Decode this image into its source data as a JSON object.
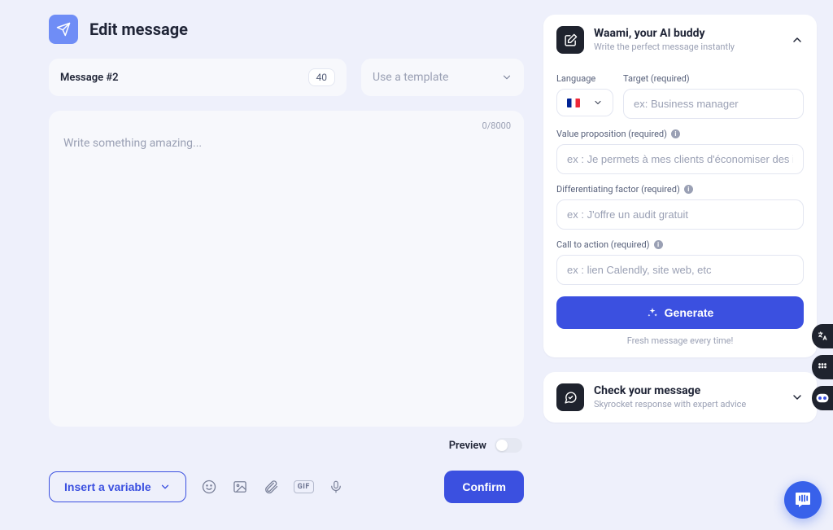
{
  "header": {
    "title": "Edit message"
  },
  "message": {
    "label": "Message #2",
    "count": "40"
  },
  "template": {
    "placeholder": "Use a template"
  },
  "editor": {
    "counter": "0/8000",
    "placeholder": "Write something amazing..."
  },
  "preview": {
    "label": "Preview"
  },
  "insert": {
    "label": "Insert a variable"
  },
  "confirm": {
    "label": "Confirm"
  },
  "ai": {
    "title": "Waami, your AI buddy",
    "subtitle": "Write the perfect message instantly",
    "language_label": "Language",
    "target": {
      "label": "Target (required)",
      "placeholder": "ex: Business manager"
    },
    "value_prop": {
      "label": "Value proposition (required)",
      "placeholder": "ex : Je permets à mes clients d'économiser des impôts"
    },
    "diff": {
      "label": "Differentiating factor (required)",
      "placeholder": "ex : J'offre un audit gratuit"
    },
    "cta": {
      "label": "Call to action (required)",
      "placeholder": "ex : lien Calendly, site web, etc"
    },
    "generate": "Generate",
    "fresh": "Fresh message every time!"
  },
  "check": {
    "title": "Check your message",
    "subtitle": "Skyrocket response with expert advice"
  },
  "gif_label": "GIF"
}
